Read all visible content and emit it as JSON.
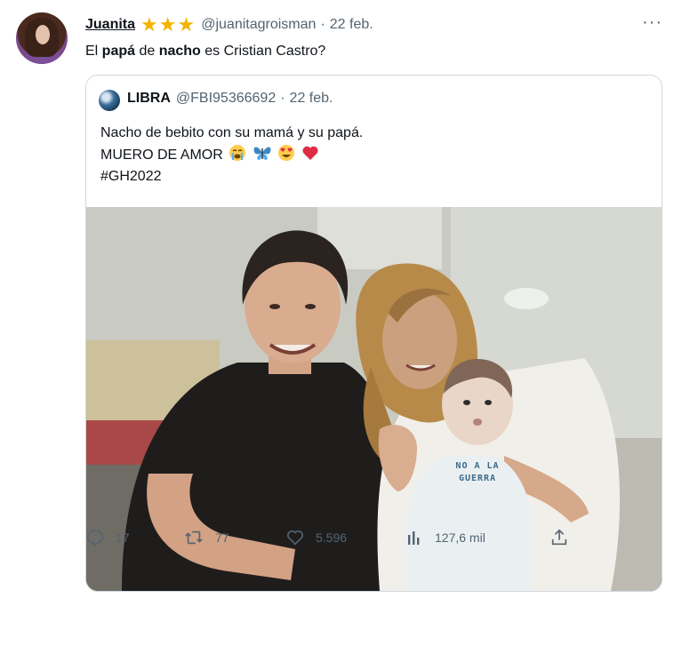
{
  "tweet": {
    "display_name": "Juanita",
    "handle": "@juanitagroisman",
    "separator": "·",
    "date": "22 feb.",
    "more_label": "···",
    "text_parts": [
      "El ",
      "papá",
      " de ",
      "nacho",
      " es Cristian Castro?"
    ]
  },
  "quote": {
    "display_name": "LIBRA",
    "handle": "@FBI95366692",
    "separator": "·",
    "date": "22 feb.",
    "line1": "Nacho de bebito con su mamá y su papá.",
    "line2": "MUERO DE AMOR",
    "line3": "#GH2022",
    "emojis": [
      "crying-face-icon",
      "butterfly-icon",
      "heart-eyes-icon",
      "red-heart-icon"
    ],
    "photo_text": "NO A LA GUERRA"
  },
  "actions": {
    "replies": "17",
    "retweets": "77",
    "likes": "5.596",
    "views": "127,6 mil"
  },
  "colors": {
    "star": "#f4b400",
    "muted": "#536471",
    "border": "#cfd9de",
    "text": "#0f1419"
  }
}
